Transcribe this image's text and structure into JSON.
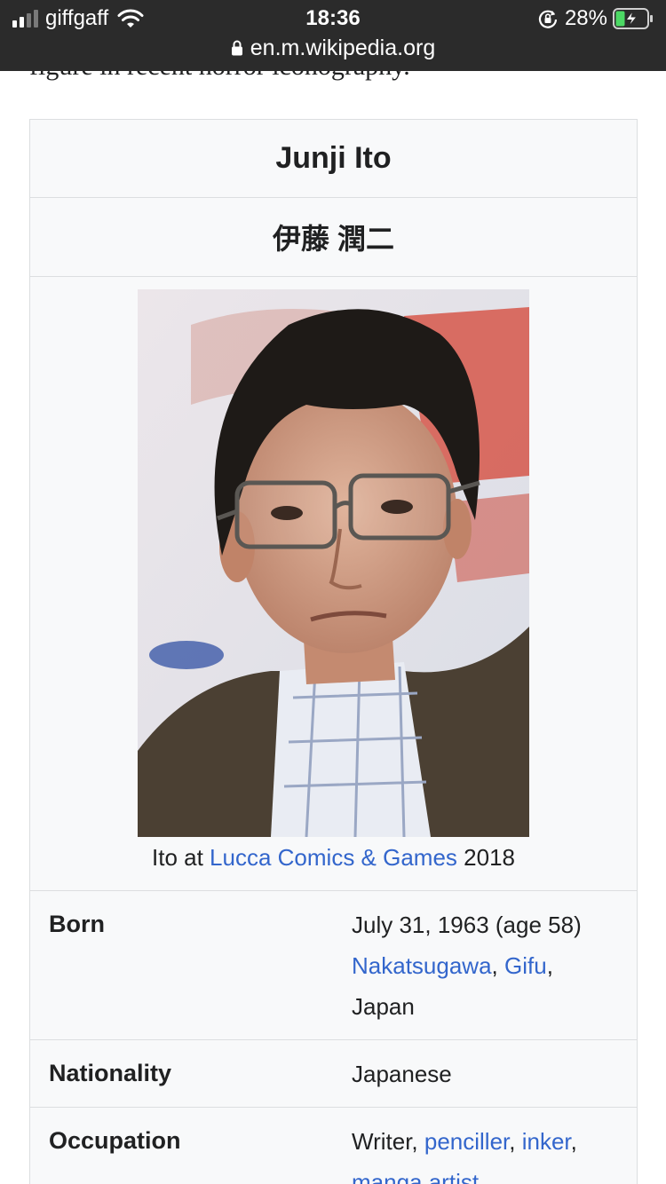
{
  "status_bar": {
    "carrier": "giffgaff",
    "time": "18:36",
    "battery_percent": "28%",
    "url": "en.m.wikipedia.org",
    "signal_bars_active": 2,
    "signal_bars_total": 4
  },
  "page": {
    "cut_off_text": "figure in recent horror iconography."
  },
  "infobox": {
    "title": "Junji Ito",
    "native_name": "伊藤 潤二",
    "image_caption": {
      "prefix": "Ito at ",
      "link": "Lucca Comics & Games",
      "suffix": " 2018"
    },
    "born": {
      "label": "Born",
      "date": "July 31, 1963 (age 58)",
      "place_link_1": "Nakatsugawa",
      "sep": ", ",
      "place_link_2": "Gifu",
      "comma": ",",
      "country": "Japan"
    },
    "nationality": {
      "label": "Nationality",
      "value": "Japanese"
    },
    "occupation": {
      "label": "Occupation",
      "plain": "Writer, ",
      "link_1": "penciller",
      "sep": ", ",
      "link_2": "inker",
      "comma": ",",
      "link_3": "manga artist"
    }
  },
  "colors": {
    "link": "#3366cc",
    "infobox_bg": "#f8f9fa",
    "status_bar_bg": "#2b2b2b",
    "battery_charge": "#4cd964"
  }
}
